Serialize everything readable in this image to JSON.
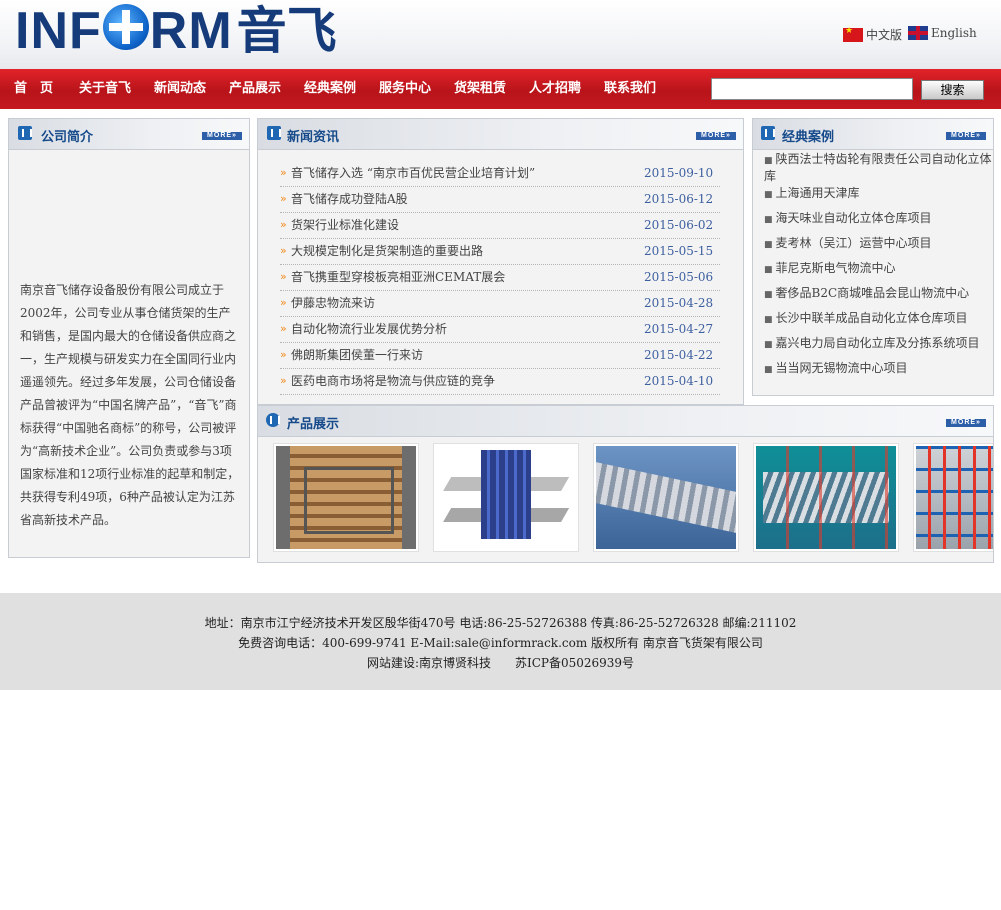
{
  "header": {
    "logo_text": "INF",
    "logo_text2": "RM",
    "logo_cn": "音飞",
    "lang_cn": "中文版",
    "lang_en": "English"
  },
  "nav": {
    "items": [
      "首　页",
      "关于音飞",
      "新闻动态",
      "产品展示",
      "经典案例",
      "服务中心",
      "货架租赁",
      "人才招聘",
      "联系我们"
    ],
    "search_placeholder": "",
    "search_button": "搜索"
  },
  "about": {
    "title": "公司简介",
    "more": "MORE»",
    "text": "南京音飞储存设备股份有限公司成立于2002年，公司专业从事仓储货架的生产和销售，是国内最大的仓储设备供应商之一，生产规模与研发实力在全国同行业内遥遥领先。经过多年发展，公司仓储设备产品曾被评为“中国名牌产品”，“音飞”商标获得“中国驰名商标”的称号，公司被评为“高新技术企业”。公司负责或参与3项国家标准和12项行业标准的起草和制定，共获得专利49项，6种产品被认定为江苏省高新技术产品。"
  },
  "news": {
    "title": "新闻资讯",
    "more": "MORE»",
    "items": [
      {
        "title": "音飞储存入选 “南京市百优民营企业培育计划”",
        "date": "2015-09-10"
      },
      {
        "title": "音飞储存成功登陆A股",
        "date": "2015-06-12"
      },
      {
        "title": "货架行业标准化建设",
        "date": "2015-06-02"
      },
      {
        "title": "大规模定制化是货架制造的重要出路",
        "date": "2015-05-15"
      },
      {
        "title": "音飞携重型穿梭板亮相亚洲CEMAT展会",
        "date": "2015-05-06"
      },
      {
        "title": "伊藤忠物流来访",
        "date": "2015-04-28"
      },
      {
        "title": "自动化物流行业发展优势分析",
        "date": "2015-04-27"
      },
      {
        "title": "佛朗斯集团侯董一行来访",
        "date": "2015-04-22"
      },
      {
        "title": "医药电商市场将是物流与供应链的竞争",
        "date": "2015-04-10"
      }
    ]
  },
  "cases": {
    "title": "经典案例",
    "more": "MORE»",
    "items": [
      "陕西法士特齿轮有限责任公司自动化立体库",
      "上海通用天津库",
      "海天味业自动化立体仓库项目",
      "麦考林（吴江）运营中心项目",
      "菲尼克斯电气物流中心",
      "奢侈品B2C商城唯品会昆山物流中心",
      "长沙中联羊成品自动化立体仓库项目",
      "嘉兴电力局自动化立库及分拣系统项目",
      "当当网无锡物流中心项目"
    ]
  },
  "products": {
    "title": "产品展示",
    "more": "MORE»"
  },
  "footer": {
    "line1": "地址：南京市江宁经济技术开发区殷华街470号 电话:86-25-52726388 传真:86-25-52726328 邮编:211102",
    "line2": "免费咨询电话：400-699-9741 E-Mail:sale@informrack.com 版权所有 南京音飞货架有限公司",
    "line3": "网站建设:南京博贤科技　　苏ICP备05026939号"
  },
  "colors": {
    "nav_red": "#c51920",
    "title_blue": "#164a8b",
    "date_blue": "#3d5fa0",
    "arrow_orange": "#f08c1e"
  }
}
